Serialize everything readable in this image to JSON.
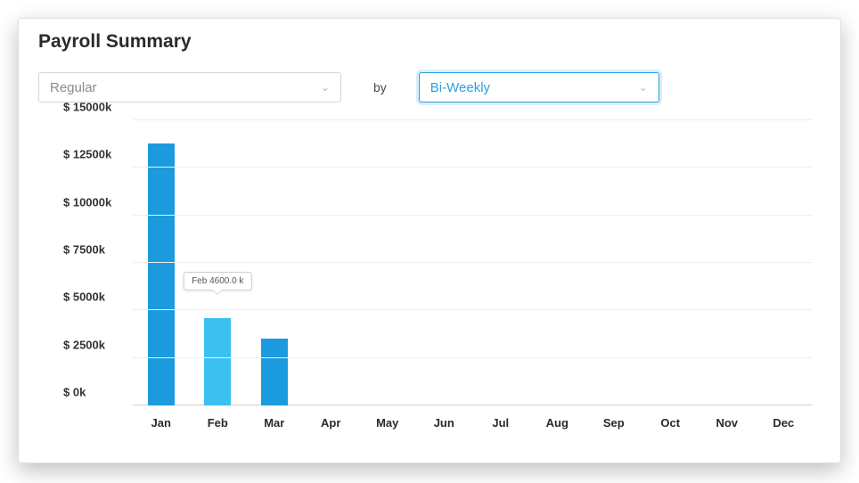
{
  "title": "Payroll Summary",
  "controls": {
    "type_select": "Regular",
    "by_label": "by",
    "period_select": "Bi-Weekly"
  },
  "y_ticks": [
    "$ 15000k",
    "$ 12500k",
    "$ 10000k",
    "$ 7500k",
    "$ 5000k",
    "$ 2500k",
    "$ 0k"
  ],
  "y_positions": [
    100,
    83.33,
    66.67,
    50,
    33.33,
    16.67,
    0
  ],
  "tooltip": {
    "text": "Feb 4600.0 k",
    "category_index": 1
  },
  "highlight_index": 1,
  "chart_data": {
    "type": "bar",
    "title": "Payroll Summary",
    "xlabel": "",
    "ylabel": "",
    "ylim": [
      0,
      15000
    ],
    "y_unit": "k",
    "y_prefix": "$",
    "categories": [
      "Jan",
      "Feb",
      "Mar",
      "Apr",
      "May",
      "Jun",
      "Jul",
      "Aug",
      "Sep",
      "Oct",
      "Nov",
      "Dec"
    ],
    "values": [
      13800,
      4600,
      3500,
      0,
      0,
      0,
      0,
      0,
      0,
      0,
      0,
      0
    ]
  }
}
